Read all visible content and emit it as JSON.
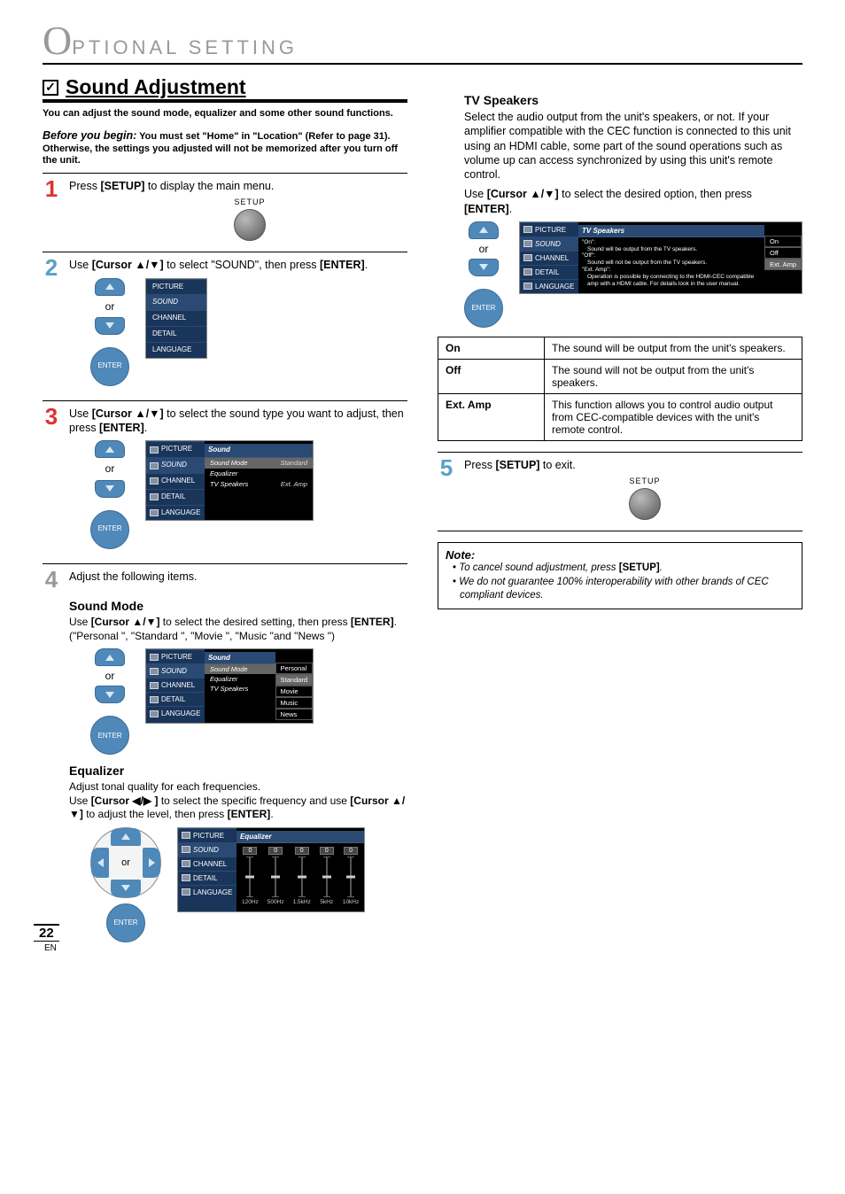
{
  "header": {
    "letter": "O",
    "rest": "PTIONAL  SETTING"
  },
  "section": {
    "check": "✓",
    "title": "Sound Adjustment",
    "intro": "You can adjust the sound mode, equalizer and some other sound functions.",
    "before_label": "Before you begin:",
    "before_text": "You must set \"Home\" in \"Location\" (Refer to page 31). Otherwise, the settings you adjusted will not be memorized after you turn off the unit."
  },
  "steps": {
    "s1": {
      "num": "1",
      "pre": "Press ",
      "key": "[SETUP]",
      "post": " to display the main menu."
    },
    "s2": {
      "num": "2",
      "pre": "Use ",
      "key": "[Cursor ▲/▼]",
      "mid": " to select \"SOUND\", then press ",
      "key2": "[ENTER]",
      "post": "."
    },
    "s3": {
      "num": "3",
      "pre": "Use ",
      "key": "[Cursor ▲/▼]",
      "mid": " to select the sound type you want to adjust, then press ",
      "key2": "[ENTER]",
      "post": "."
    },
    "s4": {
      "num": "4",
      "text": "Adjust the following items."
    },
    "s5": {
      "num": "5",
      "pre": "Press ",
      "key": "[SETUP]",
      "post": " to exit."
    }
  },
  "sound_mode": {
    "title": "Sound Mode",
    "l1a": "Use ",
    "l1key": "[Cursor ▲/▼]",
    "l1b": " to select the desired setting, then press ",
    "l1key2": "[ENTER]",
    "l1c": ".",
    "l2": "(\"Personal \", \"Standard \", \"Movie \", \"Music \"and \"News \")"
  },
  "equalizer": {
    "title": "Equalizer",
    "l1": "Adjust tonal quality for each frequencies.",
    "l2a": "Use ",
    "l2key": "[Cursor ◀/▶ ]",
    "l2b": " to select the specific frequency and use ",
    "l2key2": "[Cursor ▲/▼]",
    "l2c": " to adjust the level, then press ",
    "l2key3": "[ENTER]",
    "l2d": "."
  },
  "tv_speakers": {
    "title": "TV Speakers",
    "p1": "Select the audio output from the unit's speakers, or not. If your amplifier compatible with the CEC function is connected to this unit using an HDMI cable, some part of the sound operations such as volume up can access synchronized by using this unit's remote control.",
    "p2a": "Use ",
    "p2key": "[Cursor ▲/▼]",
    "p2b": " to select the desired option, then press ",
    "p2key2": "[ENTER]",
    "p2c": "."
  },
  "tv_table": {
    "r1": {
      "k": "On",
      "v": "The sound will be output from the unit's speakers."
    },
    "r2": {
      "k": "Off",
      "v": "The sound will not be output from the unit's speakers."
    },
    "r3": {
      "k": "Ext. Amp",
      "v": "This function allows you to control audio output from CEC-compatible devices with the unit's remote control."
    }
  },
  "note": {
    "title": "Note:",
    "i1a": "To cancel sound adjustment, press ",
    "i1key": "[SETUP]",
    "i1b": ".",
    "i2": "We do not guarantee 100% interoperability with other brands of CEC compliant devices."
  },
  "remote": {
    "setup": "SETUP",
    "enter": "ENTER",
    "or": "or"
  },
  "osd": {
    "menu": {
      "picture": "PICTURE",
      "sound": "SOUND",
      "channel": "CHANNEL",
      "detail": "DETAIL",
      "language": "LANGUAGE"
    },
    "sound_hdr": "Sound",
    "tvspk_hdr": "TV Speakers",
    "eq_hdr": "Equalizer",
    "rows": {
      "mode": "Sound Mode",
      "eq": "Equalizer",
      "spk": "TV Speakers"
    },
    "vals": {
      "standard": "Standard",
      "extamp": "Ext. Amp",
      "personal": "Personal",
      "movie": "Movie",
      "music": "Music",
      "news": "News",
      "on": "On",
      "off": "Off"
    },
    "tvspk_note": {
      "on_h": "\"On\":",
      "on_t": "Sound will be output from the TV speakers.",
      "off_h": "\"Off\":",
      "off_t": "Sound will not be output from the TV speakers.",
      "ext_h": "\"Ext. Amp\":",
      "ext_t": "Operation is possible by connecting to the HDMI-CEC compatible amp with a HDMI cable. For details look in the user manual."
    }
  },
  "chart_data": {
    "type": "bar",
    "title": "Equalizer",
    "categories": [
      "120Hz",
      "500Hz",
      "1.5kHz",
      "5kHz",
      "10kHz"
    ],
    "values": [
      0,
      0,
      0,
      0,
      0
    ],
    "ylim": [
      -10,
      10
    ]
  },
  "page": {
    "num": "22",
    "lang": "EN"
  }
}
